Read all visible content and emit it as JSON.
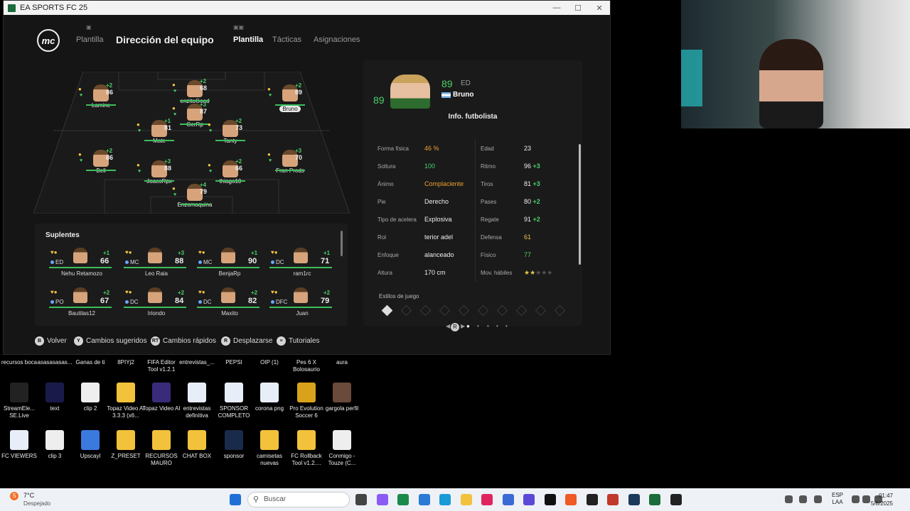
{
  "window": {
    "title": "EA SPORTS FC 25",
    "controls": [
      "—",
      "☐",
      "✕"
    ]
  },
  "nav": {
    "tab_plantilla_left": "Plantilla",
    "title": "Dirección del equipo",
    "tab_plantilla": "Plantilla",
    "tab_tacticas": "Tácticas",
    "tab_asignaciones": "Asignaciones",
    "logo": "mc"
  },
  "pitch_players": [
    {
      "name": "Lamine",
      "rating": "86",
      "plus": "+2"
    },
    {
      "name": "enzitoGood",
      "rating": "68",
      "plus": "+2"
    },
    {
      "name": "Bruno",
      "rating": "89",
      "plus": "+2"
    },
    {
      "name": "GerRp",
      "rating": "87",
      "plus": "+3"
    },
    {
      "name": "Mate",
      "rating": "81",
      "plus": "+1"
    },
    {
      "name": "Tanty",
      "rating": "73",
      "plus": "+2"
    },
    {
      "name": "Bell",
      "rating": "86",
      "plus": "+2"
    },
    {
      "name": "JoacoRpx",
      "rating": "88",
      "plus": "+3"
    },
    {
      "name": "thiago10",
      "rating": "66",
      "plus": "+2"
    },
    {
      "name": "Fran Prods",
      "rating": "70",
      "plus": "+3"
    },
    {
      "name": "Enzomaquina",
      "rating": "79",
      "plus": "+4"
    }
  ],
  "subs": {
    "title": "Suplentes",
    "players": [
      {
        "pos": "ED",
        "name": "Nehu Retamozo",
        "rating": "66",
        "plus": "+1"
      },
      {
        "pos": "MC",
        "name": "Leo Raia",
        "rating": "88",
        "plus": "+3"
      },
      {
        "pos": "MC",
        "name": "BenjaRp",
        "rating": "90",
        "plus": "+1"
      },
      {
        "pos": "DC",
        "name": "ram1rc",
        "rating": "71",
        "plus": "+1"
      },
      {
        "pos": "PO",
        "name": "Bautitas12",
        "rating": "67",
        "plus": "+2"
      },
      {
        "pos": "DC",
        "name": "Iriondo",
        "rating": "84",
        "plus": "+2"
      },
      {
        "pos": "DC",
        "name": "Maxito",
        "rating": "82",
        "plus": "+2"
      },
      {
        "pos": "DFC",
        "name": "Juan",
        "rating": "79",
        "plus": "+2"
      }
    ]
  },
  "detail": {
    "rating": "89",
    "pos": "ED",
    "name": "Bruno",
    "info_title": "Info. futbolista",
    "left_attrs": [
      {
        "label": "Forma física",
        "value": "46 %"
      },
      {
        "label": "Soltura",
        "value": "100"
      },
      {
        "label": "Ánimo",
        "value": "Complaciente"
      },
      {
        "label": "Pie",
        "value": "Derecho"
      },
      {
        "label": "Tipo de acelera",
        "value": "Explosiva"
      },
      {
        "label": "Rol",
        "value": "terior adel"
      },
      {
        "label": "Enfoque",
        "value": "alanceado"
      },
      {
        "label": "Altura",
        "value": "170 cm"
      }
    ],
    "right_attrs": [
      {
        "label": "Edad",
        "value": "23",
        "delta": ""
      },
      {
        "label": "Ritmo",
        "value": "96",
        "delta": "+3"
      },
      {
        "label": "Tiros",
        "value": "81",
        "delta": "+3"
      },
      {
        "label": "Pases",
        "value": "80",
        "delta": "+2"
      },
      {
        "label": "Regate",
        "value": "91",
        "delta": "+2"
      },
      {
        "label": "Defensa",
        "value": "61",
        "delta": ""
      },
      {
        "label": "Físico",
        "value": "77",
        "delta": ""
      },
      {
        "label": "Mov. hábiles",
        "value": "★★★★★",
        "delta": ""
      }
    ],
    "skill_stars": 2,
    "estilos": "Estilos de juego",
    "pager_button": "R"
  },
  "hints": [
    {
      "btn": "B",
      "label": "Volver"
    },
    {
      "btn": "Y",
      "label": "Cambios sugeridos"
    },
    {
      "btn": "RT",
      "label": "Cambios rápidos"
    },
    {
      "btn": "R",
      "label": "Desplazarse"
    },
    {
      "btn": "≡",
      "label": "Tutoriales"
    }
  ],
  "desktop_top_row": [
    "recursos boca",
    "asasasasas...",
    "Ganas de ti",
    "8PIYj2",
    "FIFA Editor Tool v1.2.1",
    "entrevistas_...",
    "PEPSI",
    "OIP (1)",
    "Pes 6 X Bolosaurio",
    "aura"
  ],
  "desktop_row2": [
    "StreamEle... SE.Live",
    "text",
    "clip 2",
    "Topaz Video AI 3.3.3 (x6...",
    "Topaz Video AI",
    "entrevistas definitiva",
    "SPONSOR COMPLETO",
    "corona png",
    "Pro Evolution Soccer 6",
    "gargola perfil"
  ],
  "desktop_row3": [
    "FC VIEWERS",
    "clip 3",
    "Upscayl",
    "Z_PRESET",
    "RECURSOS MAURO",
    "CHAT BOX",
    "sponsor",
    "camisetas nuevas",
    "FC Rollback Tool v1.2....",
    "Conmigo - Touze (C..."
  ],
  "taskbar": {
    "weather_temp": "7°C",
    "weather_desc": "Despejado",
    "weather_badge": "5",
    "search_placeholder": "Buscar",
    "lang1": "ESP",
    "lang2": "LAA",
    "time": "01:47",
    "date": "5/8/2025"
  }
}
